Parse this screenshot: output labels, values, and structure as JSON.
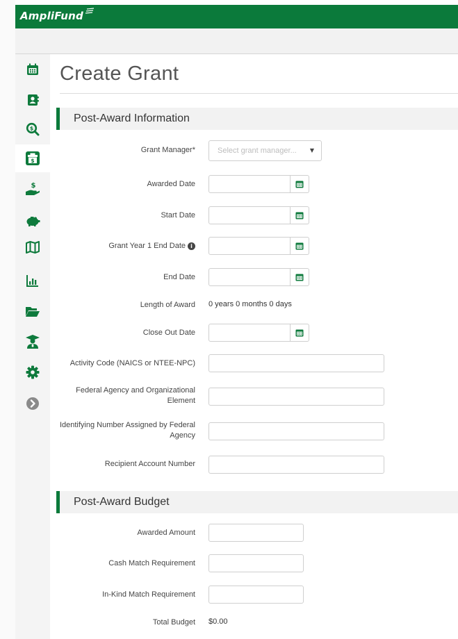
{
  "app": {
    "brand": "AmpliFund"
  },
  "sidebar": {
    "items": [
      {
        "icon": "calendar-icon",
        "active": false
      },
      {
        "icon": "contacts-icon",
        "active": false
      },
      {
        "icon": "search-funding-icon",
        "active": false
      },
      {
        "icon": "grants-box-icon",
        "active": true
      },
      {
        "icon": "payment-hand-icon",
        "active": false
      },
      {
        "icon": "piggy-bank-icon",
        "active": false
      },
      {
        "icon": "map-icon",
        "active": false
      },
      {
        "icon": "bar-chart-icon",
        "active": false
      },
      {
        "icon": "folder-open-icon",
        "active": false
      },
      {
        "icon": "graduate-icon",
        "active": false
      },
      {
        "icon": "gear-icon",
        "active": false
      },
      {
        "icon": "chevron-right-circle-icon",
        "active": false
      }
    ]
  },
  "page": {
    "title": "Create Grant"
  },
  "post_award_info": {
    "header": "Post-Award Information",
    "grant_manager_label": "Grant Manager*",
    "grant_manager_placeholder": "Select grant manager...",
    "awarded_date_label": "Awarded Date",
    "awarded_date_value": "",
    "start_date_label": "Start Date",
    "start_date_value": "",
    "year1_end_label": "Grant Year 1 End Date",
    "year1_end_value": "",
    "end_date_label": "End Date",
    "end_date_value": "",
    "length_label": "Length of Award",
    "length_value": "0 years 0 months 0 days",
    "close_out_label": "Close Out Date",
    "close_out_value": "",
    "activity_code_label": "Activity Code (NAICS or NTEE-NPC)",
    "activity_code_value": "",
    "federal_agency_label": "Federal Agency and Organizational Element",
    "federal_agency_value": "",
    "identifying_number_label": "Identifying Number Assigned by Federal Agency",
    "identifying_number_value": "",
    "recipient_account_label": "Recipient Account Number",
    "recipient_account_value": ""
  },
  "post_award_budget": {
    "header": "Post-Award Budget",
    "awarded_amount_label": "Awarded Amount",
    "awarded_amount_value": "",
    "cash_match_label": "Cash Match Requirement",
    "cash_match_value": "",
    "in_kind_label": "In-Kind Match Requirement",
    "in_kind_value": "",
    "total_budget_label": "Total Budget",
    "total_budget_value": "$0.00"
  },
  "colors": {
    "brand_green": "#0b7a3b",
    "icon_green": "#0e7a3c",
    "section_bg": "#f2f2f2"
  }
}
